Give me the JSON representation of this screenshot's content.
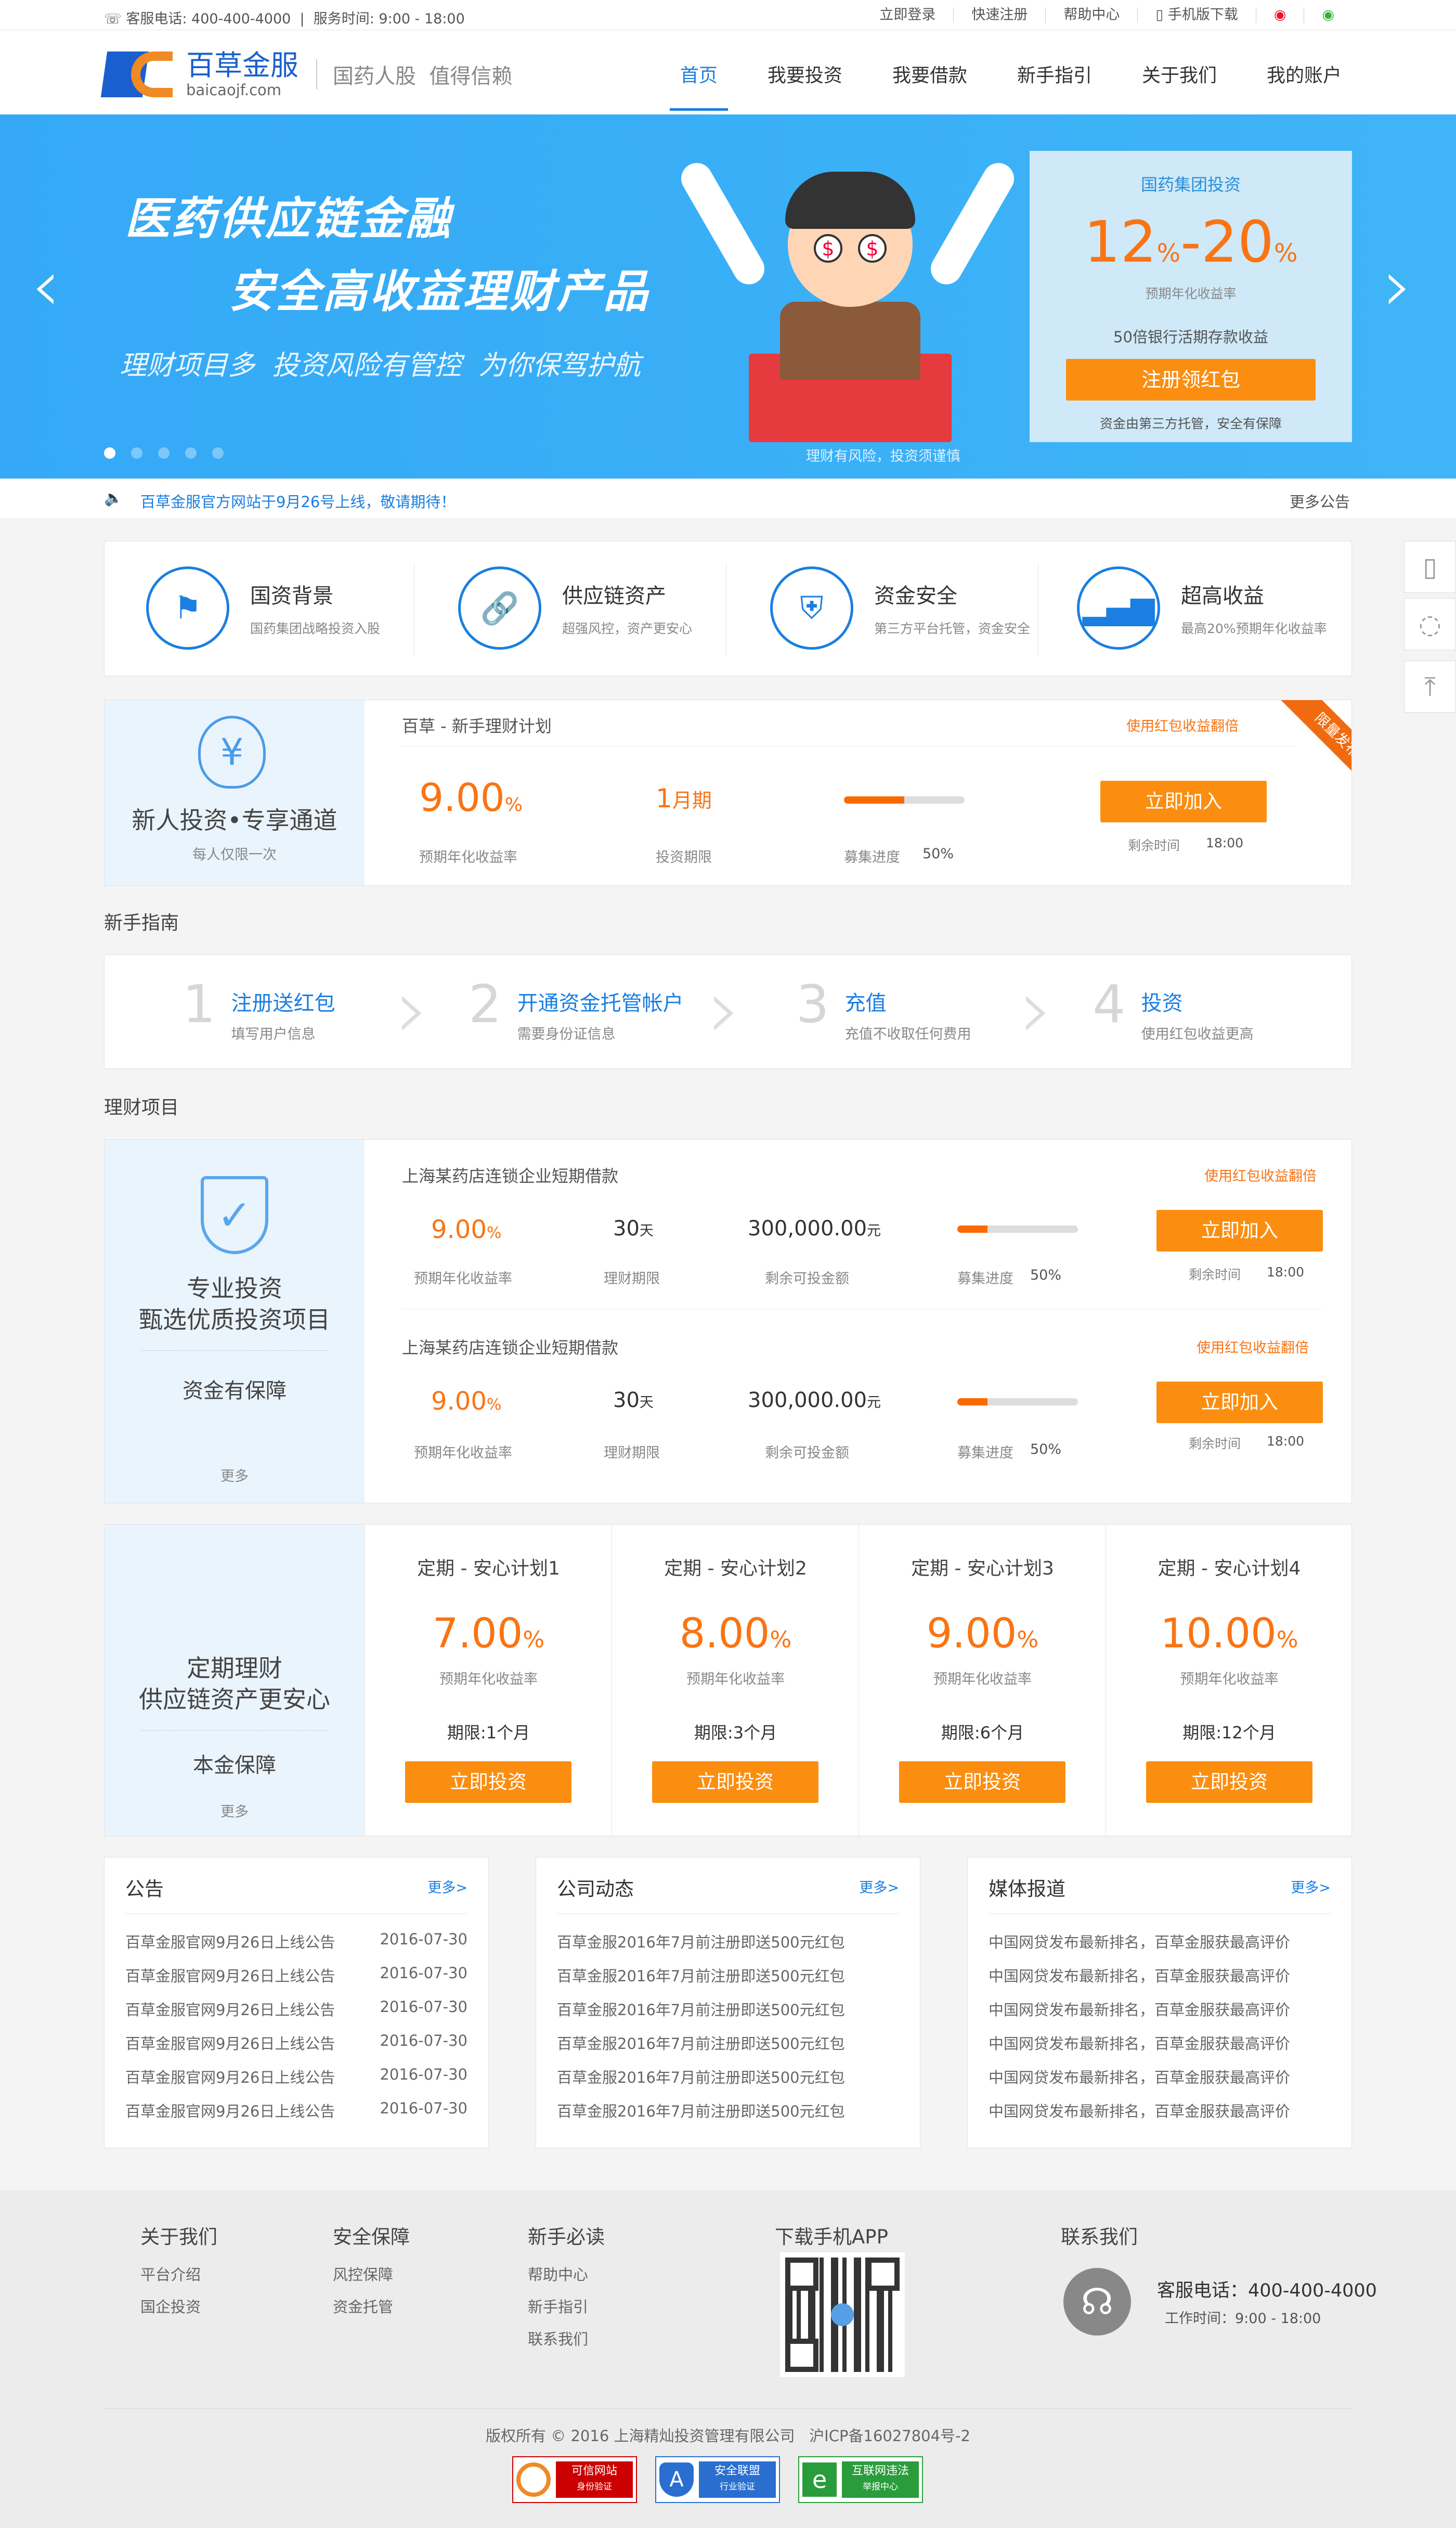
{
  "topbar": {
    "phone": "客服电话: 400-400-4000",
    "hours": "服务时间: 9:00 - 18:00",
    "links": [
      "立即登录",
      "快速注册",
      "帮助中心",
      "手机版下载"
    ]
  },
  "logo": {
    "name": "百草金服",
    "domain": "baicaojf.com",
    "slogan": "国药人股  值得信赖"
  },
  "nav": [
    "首页",
    "我要投资",
    "我要借款",
    "新手指引",
    "关于我们",
    "我的账户"
  ],
  "banner": {
    "title1": "医药供应链金融",
    "title2": "安全高收益理财产品",
    "subtitle": "理财项目多  投资风险有管控  为你保驾护航",
    "risk": "理财有风险，投资须谨慎",
    "card": {
      "title": "国药集团投资",
      "rate_low": "12",
      "rate_high": "20",
      "pct": "%",
      "dash": "-",
      "rate_label": "预期年化收益率",
      "multiple": "50倍银行活期存款收益",
      "button": "注册领红包",
      "note": "资金由第三方托管，安全有保障"
    }
  },
  "notice": {
    "text": "百草金服官方网站于9月26号上线，敬请期待！",
    "more": "更多公告"
  },
  "features": [
    {
      "title": "国资背景",
      "desc": "国药集团战略投资入股"
    },
    {
      "title": "供应链资产",
      "desc": "超强风控，资产更安心"
    },
    {
      "title": "资金安全",
      "desc": "第三方平台托管，资金安全"
    },
    {
      "title": "超高收益",
      "desc": "最高20%预期年化收益率"
    }
  ],
  "newbie": {
    "title": "新人投资•专享通道",
    "sub": "每人仅限一次",
    "plan": "百草 - 新手理财计划",
    "tip": "使用红包收益翻倍",
    "ribbon": "限量发布",
    "rate": "9.00",
    "rate_unit": "%",
    "rate_label": "预期年化收益率",
    "term": "1",
    "term_unit": "月期",
    "term_label": "投资期限",
    "progress_label": "募集进度",
    "progress": "50%",
    "button": "立即加入",
    "remain_label": "剩余时间",
    "remain": "18:00"
  },
  "guide": {
    "heading": "新手指南",
    "steps": [
      {
        "n": "1",
        "title": "注册送红包",
        "desc": "填写用户信息"
      },
      {
        "n": "2",
        "title": "开通资金托管帐户",
        "desc": "需要身份证信息"
      },
      {
        "n": "3",
        "title": "充值",
        "desc": "充值不收取任何费用"
      },
      {
        "n": "4",
        "title": "投资",
        "desc": "使用红包收益更高"
      }
    ]
  },
  "projects": {
    "heading": "理财项目",
    "side": {
      "t1": "专业投资",
      "t2": "甄选优质投资项目",
      "t3": "资金有保障",
      "more": "更多"
    },
    "items": [
      {
        "name": "上海某药店连锁企业短期借款",
        "tip": "使用红包收益翻倍",
        "rate": "9.00",
        "pct": "%",
        "rate_label": "预期年化收益率",
        "term": "30",
        "term_unit": "天",
        "term_label": "理财期限",
        "amount": "300,000.00",
        "amount_unit": "元",
        "amount_label": "剩余可投金额",
        "progress_label": "募集进度",
        "progress": "50%",
        "button": "立即加入",
        "remain_label": "剩余时间",
        "remain": "18:00"
      },
      {
        "name": "上海某药店连锁企业短期借款",
        "tip": "使用红包收益翻倍",
        "rate": "9.00",
        "pct": "%",
        "rate_label": "预期年化收益率",
        "term": "30",
        "term_unit": "天",
        "term_label": "理财期限",
        "amount": "300,000.00",
        "amount_unit": "元",
        "amount_label": "剩余可投金额",
        "progress_label": "募集进度",
        "progress": "50%",
        "button": "立即加入",
        "remain_label": "剩余时间",
        "remain": "18:00"
      }
    ]
  },
  "fixed": {
    "side": {
      "t1": "定期理财",
      "t2": "供应链资产更安心",
      "t3": "本金保障",
      "more": "更多"
    },
    "plans": [
      {
        "name": "定期 - 安心计划1",
        "rate": "7.00",
        "term": "1个月"
      },
      {
        "name": "定期 - 安心计划2",
        "rate": "8.00",
        "term": "3个月"
      },
      {
        "name": "定期 - 安心计划3",
        "rate": "9.00",
        "term": "6个月"
      },
      {
        "name": "定期 - 安心计划4",
        "rate": "10.00",
        "term": "12个月"
      }
    ],
    "pct": "%",
    "rate_label": "预期年化收益率",
    "term_label": "期限:",
    "button": "立即投资"
  },
  "news": [
    {
      "title": "公告",
      "more": "更多>",
      "items": [
        {
          "t": "百草金服官网9月26日上线公告",
          "d": "2016-07-30"
        },
        {
          "t": "百草金服官网9月26日上线公告",
          "d": "2016-07-30"
        },
        {
          "t": "百草金服官网9月26日上线公告",
          "d": "2016-07-30"
        },
        {
          "t": "百草金服官网9月26日上线公告",
          "d": "2016-07-30"
        },
        {
          "t": "百草金服官网9月26日上线公告",
          "d": "2016-07-30"
        },
        {
          "t": "百草金服官网9月26日上线公告",
          "d": "2016-07-30"
        }
      ]
    },
    {
      "title": "公司动态",
      "more": "更多>",
      "items": [
        {
          "t": "百草金服2016年7月前注册即送500元红包",
          "d": ""
        },
        {
          "t": "百草金服2016年7月前注册即送500元红包",
          "d": ""
        },
        {
          "t": "百草金服2016年7月前注册即送500元红包",
          "d": ""
        },
        {
          "t": "百草金服2016年7月前注册即送500元红包",
          "d": ""
        },
        {
          "t": "百草金服2016年7月前注册即送500元红包",
          "d": ""
        },
        {
          "t": "百草金服2016年7月前注册即送500元红包",
          "d": ""
        }
      ]
    },
    {
      "title": "媒体报道",
      "more": "更多>",
      "items": [
        {
          "t": "中国网贷发布最新排名，百草金服获最高评价",
          "d": ""
        },
        {
          "t": "中国网贷发布最新排名，百草金服获最高评价",
          "d": ""
        },
        {
          "t": "中国网贷发布最新排名，百草金服获最高评价",
          "d": ""
        },
        {
          "t": "中国网贷发布最新排名，百草金服获最高评价",
          "d": ""
        },
        {
          "t": "中国网贷发布最新排名，百草金服获最高评价",
          "d": ""
        },
        {
          "t": "中国网贷发布最新排名，百草金服获最高评价",
          "d": ""
        }
      ]
    }
  ],
  "footer": {
    "cols": [
      {
        "h": "关于我们",
        "items": [
          "平台介绍",
          "国企投资"
        ]
      },
      {
        "h": "安全保障",
        "items": [
          "风控保障",
          "资金托管"
        ]
      },
      {
        "h": "新手必读",
        "items": [
          "帮助中心",
          "新手指引",
          "联系我们"
        ]
      }
    ],
    "app": "下载手机APP",
    "contact": "联系我们",
    "phone": "客服电话：400-400-4000",
    "hours": "工作时间：9:00 - 18:00",
    "copyright": "版权所有 © 2016 上海精灿投资管理有限公司   沪ICP备16027804号-2",
    "badges": [
      {
        "t1": "可信网站",
        "t2": "身份验证"
      },
      {
        "t1": "安全联盟",
        "t2": "行业验证"
      },
      {
        "t1": "互联网违法",
        "t2": "举报中心"
      }
    ]
  },
  "colors": {
    "blue": "#1a7fe0",
    "orange": "#fb8e10",
    "banner": "#38acf6"
  }
}
